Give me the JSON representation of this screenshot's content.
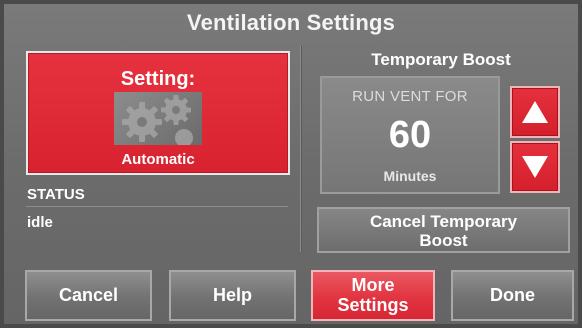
{
  "screen": {
    "title": "Ventilation Settings"
  },
  "setting": {
    "label": "Setting:",
    "value": "Automatic",
    "icon": "gears-icon"
  },
  "status": {
    "label": "STATUS",
    "value": "idle"
  },
  "boost": {
    "title": "Temporary Boost",
    "run_label": "RUN VENT FOR",
    "value": "60",
    "unit": "Minutes",
    "up_icon": "arrow-up-icon",
    "down_icon": "arrow-down-icon",
    "cancel_label_line1": "Cancel Temporary",
    "cancel_label_line2": "Boost"
  },
  "footer": {
    "cancel_label": "Cancel",
    "help_label": "Help",
    "more_label_line1": "More",
    "more_label_line2": "Settings",
    "done_label": "Done"
  },
  "colors": {
    "accent_red": "#d8222f",
    "background_gray": "#6c6c6c",
    "text_white": "#ffffff"
  }
}
